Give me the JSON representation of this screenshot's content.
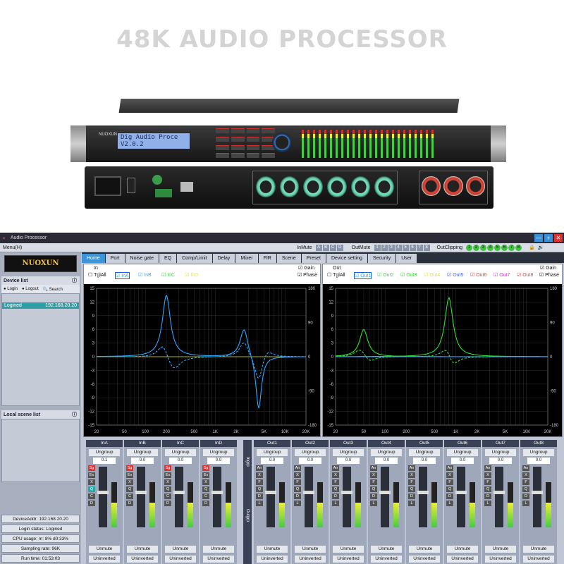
{
  "hero": {
    "title": "48K AUDIO PROCESSOR"
  },
  "device": {
    "lcd_line1": "Dig Audio Proce",
    "lcd_line2": "V2.0.2",
    "brand": "NUOXUN"
  },
  "app": {
    "title": "Audio Processor",
    "window_buttons": [
      "—",
      "+",
      "✕"
    ],
    "menu": "Menu(H)",
    "inmute_label": "InMute",
    "inmute_chips": [
      "A",
      "B",
      "C",
      "D"
    ],
    "outmute_label": "OutMute",
    "outmute_chips": [
      "1",
      "2",
      "3",
      "4",
      "5",
      "6",
      "7",
      "8"
    ],
    "outclip_label": "OutClipping",
    "outclip_chips": [
      "1",
      "2",
      "3",
      "4",
      "5",
      "6",
      "7",
      "8"
    ]
  },
  "sidebar": {
    "logo": "NUOXUN",
    "device_list_title": "Device list",
    "login": "Login",
    "logout": "Logout",
    "search": "Search",
    "device_state": "Logined",
    "device_ip": "192.168.20.20",
    "scene_title": "Local scene list",
    "status": {
      "addr": "DeviceAddr: 192.168.20.20",
      "login": "Login status: Logined",
      "cpu": "CPU usage: m: 8% d0:33%",
      "rate": "Sampling rate: 96K",
      "runtime": "Run time: 01:53:03"
    }
  },
  "tabs": [
    "Home",
    "Port",
    "Noise gate",
    "EQ",
    "Comp/Limit",
    "Delay",
    "Mixer",
    "FIR",
    "Scene",
    "Preset",
    "Device setting",
    "Security",
    "User"
  ],
  "in_graph": {
    "label": "In",
    "toggle_all": "TglAll",
    "channels": [
      "InA",
      "InB",
      "InC",
      "InD"
    ],
    "channel_colors": [
      "#2aa8ff",
      "#2aa8ff",
      "#33dd33",
      "#e6e62a"
    ],
    "gain": "Gain",
    "phase": "Phase"
  },
  "out_graph": {
    "label": "Out",
    "toggle_all": "TglAll",
    "channels": [
      "Out1",
      "Out2",
      "Out3",
      "Out4",
      "Out5",
      "Out6",
      "Out7",
      "Out8"
    ],
    "channel_colors": [
      "#2aa8ff",
      "#33dd33",
      "#33dd33",
      "#e6e62a",
      "#4466ff",
      "#ff3333",
      "#cc33cc",
      "#ff3333"
    ],
    "gain": "Gain",
    "phase": "Phase"
  },
  "axes": {
    "x_ticks": [
      "20",
      "50",
      "100",
      "200",
      "500",
      "1K",
      "2K",
      "5K",
      "10K",
      "20K"
    ],
    "y_left": [
      "15",
      "12",
      "9",
      "6",
      "3",
      "0",
      "-3",
      "-6",
      "-9",
      "-12",
      "-15"
    ],
    "y_right": [
      "180",
      "90",
      "0",
      "-90",
      "-180"
    ]
  },
  "strips": {
    "inputs": [
      "InA",
      "InB",
      "InC",
      "InD"
    ],
    "outputs": [
      "Out1",
      "Out2",
      "Out3",
      "Out4",
      "Out5",
      "Out6",
      "Out7",
      "Out8"
    ],
    "ungroup": "Ungroup",
    "in_values": [
      "0.1",
      "0.0",
      "0.0",
      "0.0"
    ],
    "out_values": [
      "0.0",
      "0.0",
      "0.0",
      "0.0",
      "0.0",
      "0.0",
      "0.0",
      "0.0"
    ],
    "unmute": "Unmute",
    "uninverted": "Uninverted",
    "in_flags": [
      "Sg",
      "Ex",
      "X",
      "Q",
      "C",
      "D"
    ],
    "out_flags": [
      "An",
      "X",
      "F",
      "Q",
      "D",
      "L"
    ],
    "in_group": "Ingrp",
    "out_group": "Outgrp",
    "meter_scale": [
      "-12",
      "-24",
      "-36",
      "-48",
      "-60",
      "-72",
      "-84"
    ],
    "in_levels": [
      0.55,
      0.55,
      0.55,
      0.55
    ],
    "out_levels": [
      0.55,
      0.55,
      0.55,
      0.55,
      0.55,
      0.55,
      0.55,
      0.55
    ]
  }
}
